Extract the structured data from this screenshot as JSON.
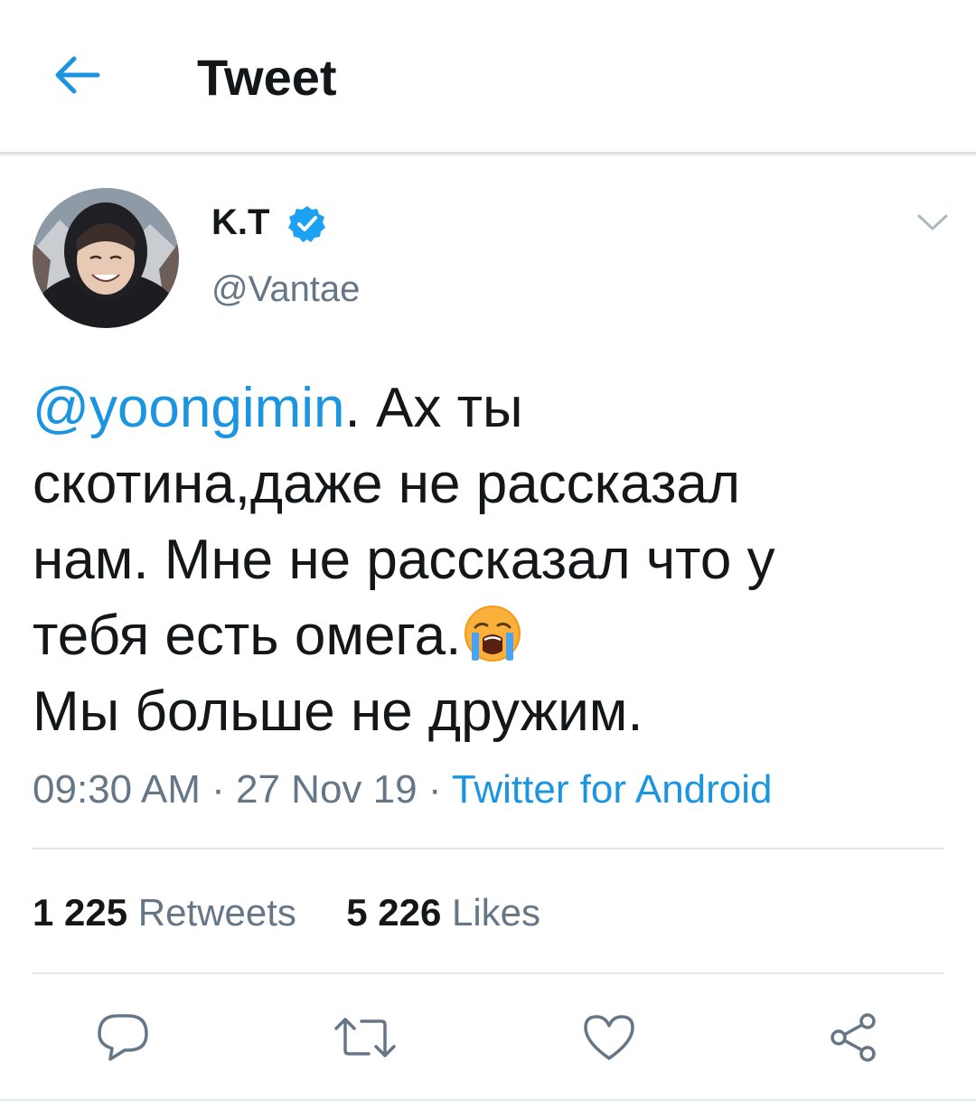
{
  "header": {
    "title": "Tweet",
    "back_icon": "arrow-left-icon"
  },
  "author": {
    "display_name": "K.T",
    "handle": "@Vantae",
    "verified": true
  },
  "tweet": {
    "lines": [
      {
        "mention": "@yoongimin",
        "text": ". Ах ты"
      },
      {
        "text": "скотина,даже не рассказал"
      },
      {
        "text": "нам. Мне не рассказал что у"
      },
      {
        "text": "тебя есть омега.",
        "emoji": "loudly-crying-face-emoji"
      },
      {
        "text": "Мы больше не дружим."
      }
    ]
  },
  "meta": {
    "time": "09:30 AM",
    "sep1": " · ",
    "date": "27 Nov 19",
    "sep2": " · ",
    "source": "Twitter for Android"
  },
  "stats": {
    "retweets_count": "1 225",
    "retweets_label": "Retweets",
    "likes_count": "5 226",
    "likes_label": "Likes"
  },
  "actions": [
    "reply-icon",
    "retweet-icon",
    "like-icon",
    "share-icon"
  ],
  "colors": {
    "accent": "#1b95e0",
    "secondary_text": "#657786",
    "divider": "#e1e8ed",
    "text": "#14171a"
  }
}
